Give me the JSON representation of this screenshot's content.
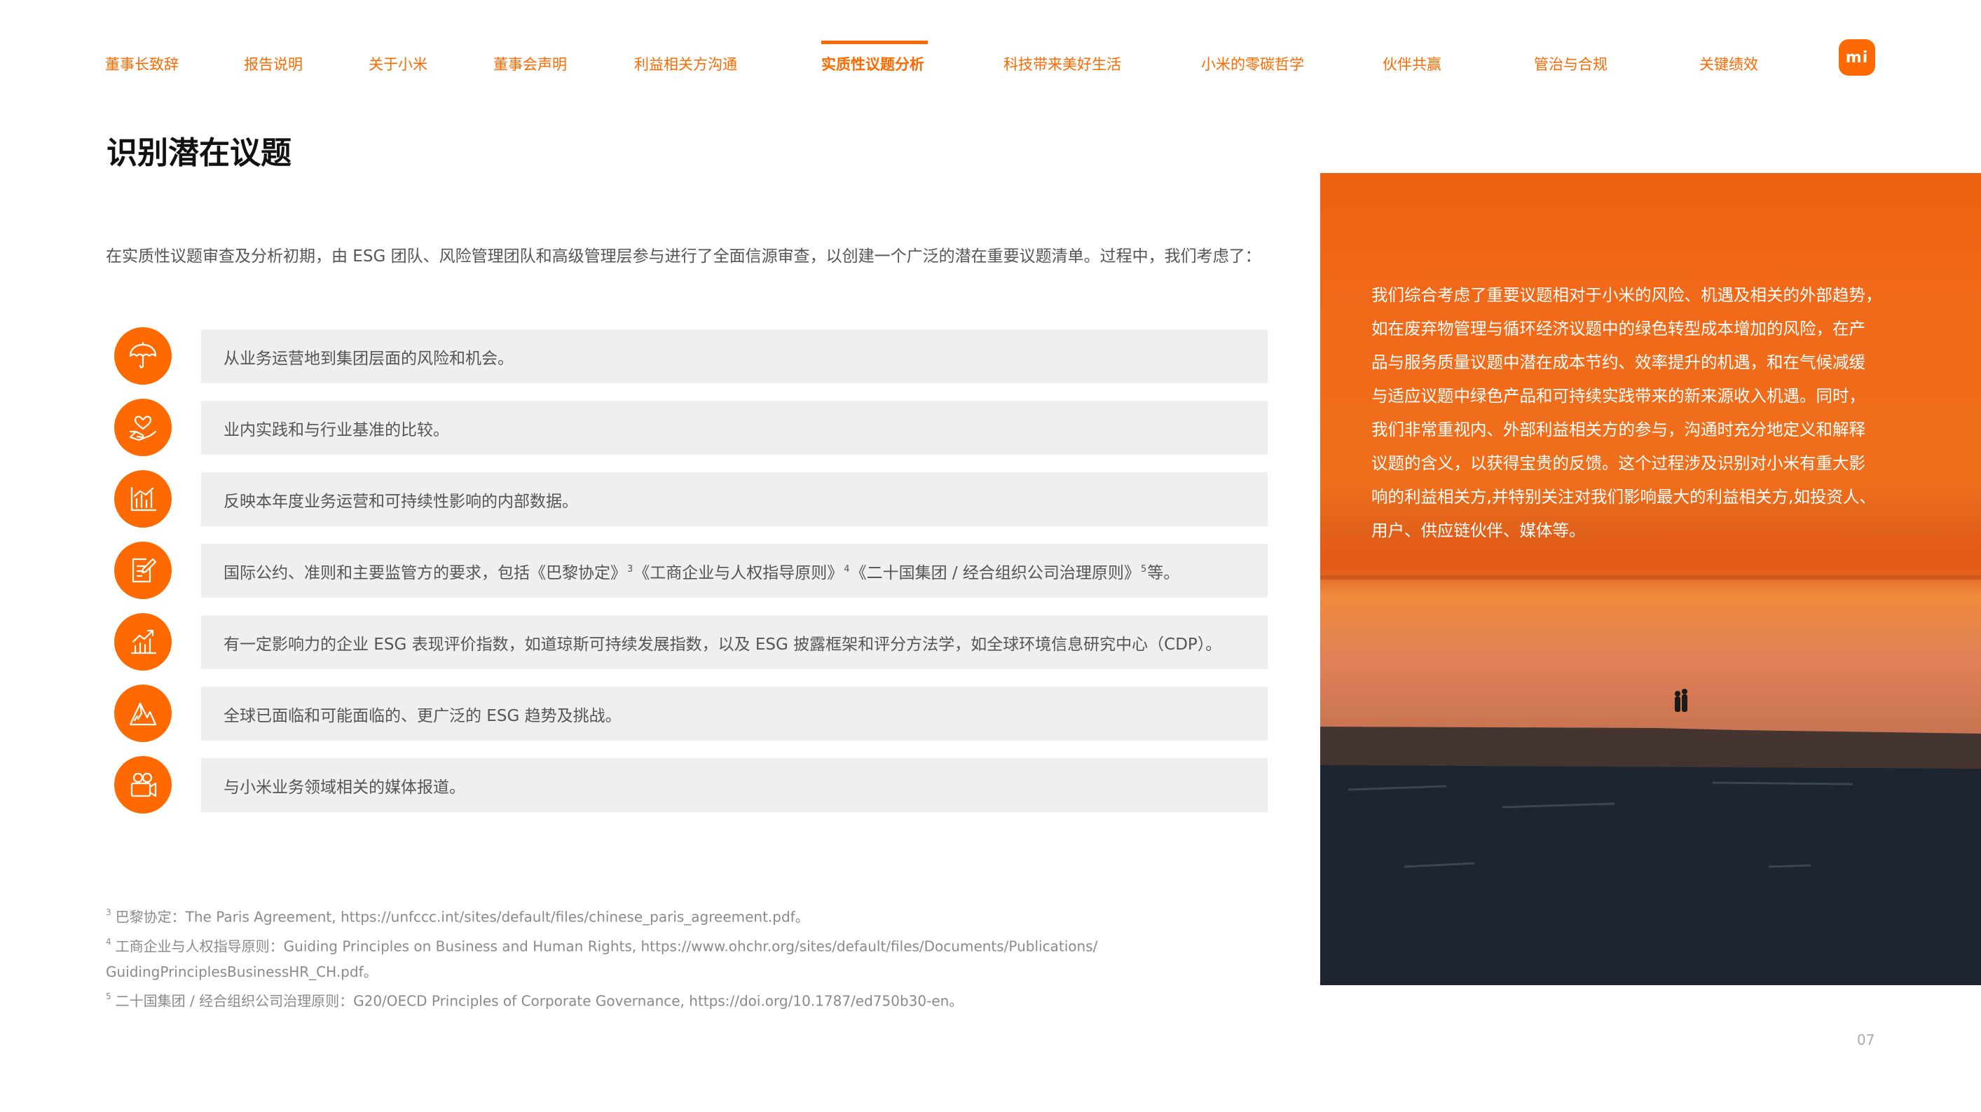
{
  "nav": {
    "items": [
      "董事长致辞",
      "报告说明",
      "关于小米",
      "董事会声明",
      "利益相关方沟通",
      "实质性议题分析",
      "科技带来美好生活",
      "小米的零碳哲学",
      "伙伴共赢",
      "管治与合规",
      "关键绩效"
    ],
    "active_index": 5,
    "logo_text": "mi",
    "accent_color": "#ff6900"
  },
  "page": {
    "title": "识别潜在议题",
    "intro": "在实质性议题审查及分析初期，由 ESG 团队、风险管理团队和高级管理层参与进行了全面信源审查，以创建一个广泛的潜在重要议题清单。过程中，我们考虑了：",
    "page_number": "07"
  },
  "items": [
    {
      "icon": "umbrella-icon",
      "text": "从业务运营地到集团层面的风险和机会。"
    },
    {
      "icon": "heart-hand-icon",
      "text": "业内实践和与行业基准的比较。"
    },
    {
      "icon": "bar-chart-icon",
      "text": "反映本年度业务运营和可持续性影响的内部数据。"
    },
    {
      "icon": "document-edit-icon",
      "text_parts": [
        "国际公约、准则和主要监管方的要求，包括《巴黎协定》",
        "3",
        "《工商企业与人权指导原则》",
        "4",
        "《二十国集团 / 经合组织公司治理原则》",
        "5",
        " 等。"
      ]
    },
    {
      "icon": "trend-chart-icon",
      "text": "有一定影响力的企业 ESG 表现评价指数，如道琼斯可持续发展指数，以及 ESG 披露框架和评分方法学，如全球环境信息研究中心（CDP）。"
    },
    {
      "icon": "mountain-icon",
      "text": "全球已面临和可能面临的、更广泛的 ESG 趋势及挑战。"
    },
    {
      "icon": "media-camera-icon",
      "text": "与小米业务领域相关的媒体报道。"
    }
  ],
  "footnotes": [
    {
      "num": "3",
      "text": "巴黎协定：The Paris Agreement, https://unfccc.int/sites/default/files/chinese_paris_agreement.pdf。"
    },
    {
      "num": "4",
      "text": "工商企业与人权指导原则：Guiding Principles on Business and Human Rights, https://www.ohchr.org/sites/default/files/Documents/Publications/"
    },
    {
      "num": "",
      "text": "GuidingPrinciplesBusinessHR_CH.pdf。"
    },
    {
      "num": "5",
      "text": "二十国集团 / 经合组织公司治理原则：G20/OECD Principles of Corporate Governance, https://doi.org/10.1787/ed750b30-en。"
    }
  ],
  "photo_text": [
    "我们综合考虑了重要议题相对于小米的风险、机遇及相关的外部趋势，",
    "如在废弃物管理与循环经济议题中的绿色转型成本增加的风险，在产",
    "品与服务质量议题中潜在成本节约、效率提升的机遇，和在气候减缓",
    "与适应议题中绿色产品和可持续实践带来的新来源收入机遇。同时，",
    "我们非常重视内、外部利益相关方的参与，沟通时充分地定义和解释",
    "议题的含义，以获得宝贵的反馈。这个过程涉及识别对小米有重大影",
    "响的利益相关方,并特别关注对我们影响最大的利益相关方,如投资人、",
    "用户、供应链伙伴、媒体等。"
  ]
}
